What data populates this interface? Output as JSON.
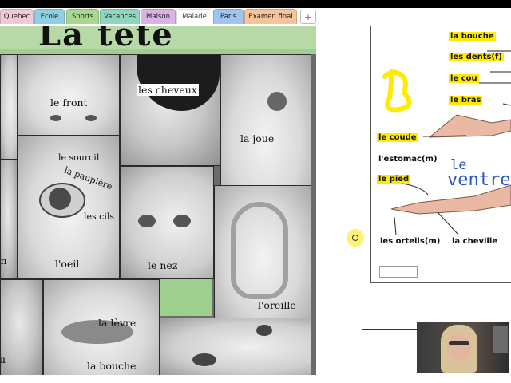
{
  "tabs": [
    {
      "label": "Quebec",
      "color": "#f0c9d8"
    },
    {
      "label": "Ecole",
      "color": "#8fd0e0"
    },
    {
      "label": "Sports",
      "color": "#a8d88f"
    },
    {
      "label": "Vacances",
      "color": "#8fd6c0"
    },
    {
      "label": "Maison",
      "color": "#d9b3e6"
    },
    {
      "label": "Malade",
      "color": "#ffffff"
    },
    {
      "label": "Paris",
      "color": "#9fc4ef"
    },
    {
      "label": "Examen final",
      "color": "#f7c49a"
    }
  ],
  "add_tab_label": "+",
  "poster": {
    "title": "La tête",
    "labels": {
      "front": "le front",
      "cheveux": "les cheveux",
      "joue": "la joue",
      "sourcil": "le sourcil",
      "paupiere": "la paupière",
      "cils": "les cils",
      "oeil": "l'oeil",
      "nez": "le nez",
      "oreille": "l'oreille",
      "levre": "la lèvre",
      "bouche": "la bouche",
      "menton_partial": "on",
      "cou_partial": "u"
    }
  },
  "worksheet": {
    "labels": {
      "bouche": "la bouche",
      "dents": "les dents(f)",
      "cou": "le cou",
      "bras": "le bras",
      "coude": "le coude",
      "estomac": "l'estomac(m)",
      "pied": "le pied",
      "orteils": "les orteils(m)",
      "cheville": "la cheville"
    },
    "handwriting": {
      "le": "le",
      "ventre": "ventre"
    },
    "highlight_color": "#ffea00"
  }
}
